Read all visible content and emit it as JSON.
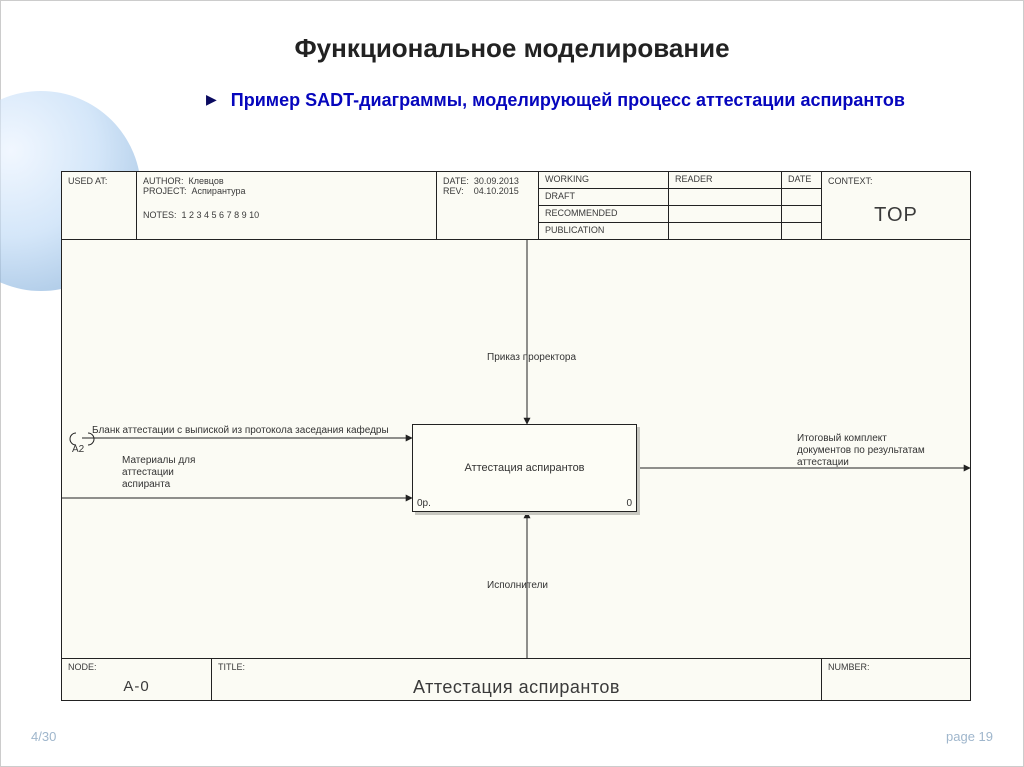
{
  "page": {
    "title": "Функциональное моделирование",
    "subtitle": "Пример SADT-диаграммы, моделирующей процесс аттестации аспирантов",
    "counter_left": "4/30",
    "counter_right": "page 19"
  },
  "header": {
    "used_at_label": "USED AT:",
    "author_label": "AUTHOR:",
    "author_value": "Клевцов",
    "project_label": "PROJECT:",
    "project_value": "Аспирантура",
    "notes_label": "NOTES:",
    "notes_value": "1  2  3  4  5  6  7  8  9  10",
    "date_label": "DATE:",
    "date_value": "30.09.2013",
    "rev_label": "REV:",
    "rev_value": "04.10.2015",
    "status": [
      "WORKING",
      "DRAFT",
      "RECOMMENDED",
      "PUBLICATION"
    ],
    "reader_label": "READER",
    "date_col_label": "DATE",
    "context_label": "CONTEXT:",
    "context_value": "TOP"
  },
  "footer": {
    "node_label": "NODE:",
    "node_value": "A-0",
    "title_label": "TITLE:",
    "title_value": "Аттестация  аспирантов",
    "number_label": "NUMBER:"
  },
  "box": {
    "name": "Аттестация  аспирантов",
    "op": "0р.",
    "zero": "0"
  },
  "arrows": {
    "control": "Приказ проректора",
    "input1": "Бланк аттестации с выпиской из протокола заседания кафедры",
    "input1_ref": "А2",
    "input2": "Материалы для аттестации аспиранта",
    "output": "Итоговый комплект документов по результатам аттестации",
    "mechanism": "Исполнители"
  }
}
